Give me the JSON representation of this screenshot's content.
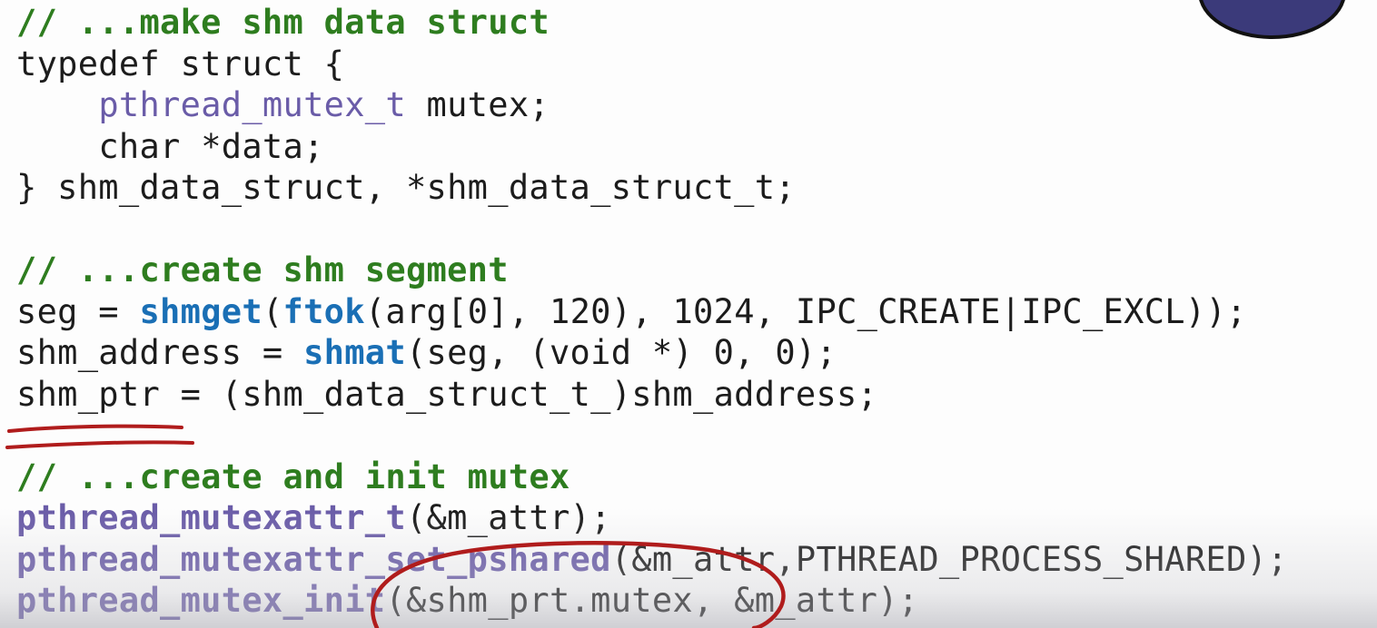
{
  "code_lines": [
    {
      "comment": "// ...make shm data struct"
    },
    {
      "plain": "typedef struct {"
    },
    {
      "indent": "    ",
      "type": "pthread_mutex_t",
      "rest": " mutex;"
    },
    {
      "indent": "    ",
      "plain": "char *data;"
    },
    {
      "plain": "} shm_data_struct, *shm_data_struct_t;"
    },
    {
      "plain": ""
    },
    {
      "comment": "// ...create shm segment"
    },
    {
      "pre": "seg = ",
      "fn1": "shmget",
      "mid1": "(",
      "fn2": "ftok",
      "rest": "(arg[0], 120), 1024, IPC_CREATE|IPC_EXCL));"
    },
    {
      "pre": "shm_address = ",
      "fn1": "shmat",
      "rest": "(seg, (void *) 0, 0);"
    },
    {
      "plain": "shm_ptr = (shm_data_struct_t_)shm_address;"
    },
    {
      "plain": ""
    },
    {
      "comment": "// ...create and init mutex"
    },
    {
      "pfn": "pthread_mutexattr_t",
      "rest": "(&m_attr);"
    },
    {
      "pfn": "pthread_mutexattr_set_pshared",
      "rest": "(&m_attr,PTHREAD_PROCESS_SHARED);"
    },
    {
      "pfn": "pthread_mutex_init",
      "rest": "(&shm_prt.mutex, &m_attr);"
    }
  ],
  "colors": {
    "comment": "#2e7d1f",
    "type": "#6a5ca8",
    "function": "#1a6fb5",
    "annotation": "#b01c1c",
    "badge": "#3b3a7a"
  },
  "annotations": [
    "underline-shm-ptr",
    "circle-mutex-init-args"
  ]
}
